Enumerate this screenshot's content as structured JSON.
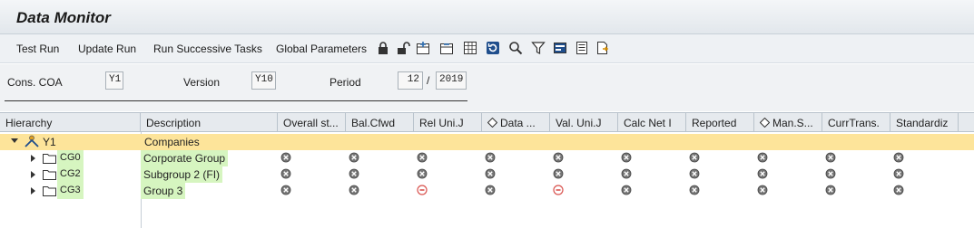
{
  "title": "Data Monitor",
  "toolbar": {
    "items": [
      "Test Run",
      "Update Run",
      "Run Successive Tasks",
      "Global Parameters"
    ],
    "icons": [
      "lock-icon",
      "unlock-icon",
      "add-column-icon",
      "remove-column-icon",
      "spreadsheet-icon",
      "refresh-icon",
      "zoom-icon",
      "filter-icon",
      "display-icon",
      "list-icon",
      "export-icon"
    ]
  },
  "selection": {
    "cons_coa_label": "Cons. COA",
    "cons_coa_value": "Y1",
    "version_label": "Version",
    "version_value": "Y10",
    "period_label": "Period",
    "period_value": "12",
    "separator": "/",
    "year_value": "2019"
  },
  "grid": {
    "columns": [
      "Hierarchy",
      "Description",
      "Overall st...",
      "Bal.Cfwd",
      "Rel Uni.J",
      "Data ...",
      "Val. Uni.J",
      "Calc Net I",
      "Reported",
      "Man.S...",
      "CurrTrans.",
      "Standardiz"
    ],
    "rows": [
      {
        "node": "Y1",
        "description": "Companies",
        "statuses": []
      },
      {
        "node": "CG0",
        "description": "Corporate Group",
        "statuses": [
          "x",
          "x",
          "x",
          "x",
          "x",
          "x",
          "x",
          "x",
          "x",
          "x"
        ]
      },
      {
        "node": "CG2",
        "description": "Subgroup 2 (FI)",
        "statuses": [
          "x",
          "x",
          "x",
          "x",
          "x",
          "x",
          "x",
          "x",
          "x",
          "x"
        ]
      },
      {
        "node": "CG3",
        "description": "Group 3",
        "statuses": [
          "x",
          "x",
          "minus",
          "x",
          "minus",
          "x",
          "x",
          "x",
          "x",
          "x"
        ]
      }
    ]
  },
  "colors": {
    "highlight": "#fde49a",
    "node_green": "#d6f5c0",
    "error_red": "#d9534f"
  }
}
